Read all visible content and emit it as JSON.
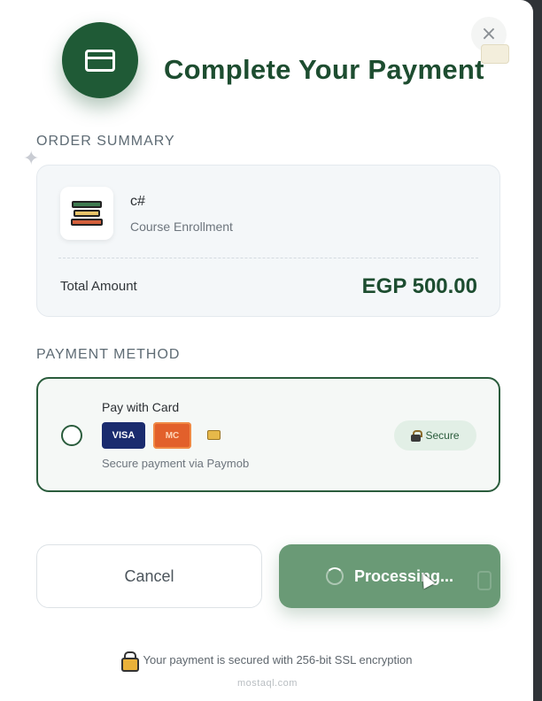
{
  "header": {
    "title": "Complete Your Payment",
    "close_symbol": "×",
    "icon": "credit-card-icon"
  },
  "order_summary": {
    "section_label": "ORDER SUMMARY",
    "course_name": "c#",
    "course_type": "Course Enrollment",
    "total_label": "Total Amount",
    "total_value": "EGP 500.00"
  },
  "payment_method": {
    "section_label": "PAYMENT METHOD",
    "option_title": "Pay with Card",
    "brands": [
      "VISA",
      "MC"
    ],
    "subtitle": "Secure payment via Paymob",
    "secure_badge": "Secure",
    "selected": false
  },
  "actions": {
    "cancel_label": "Cancel",
    "submit_label": "Processing..."
  },
  "footer": {
    "note": "Your payment is secured with 256-bit SSL encryption"
  },
  "watermark": "mostaql.com",
  "colors": {
    "brand_green": "#1d4d30",
    "button_green": "#6a9a76",
    "border_green": "#2a5c3c"
  }
}
